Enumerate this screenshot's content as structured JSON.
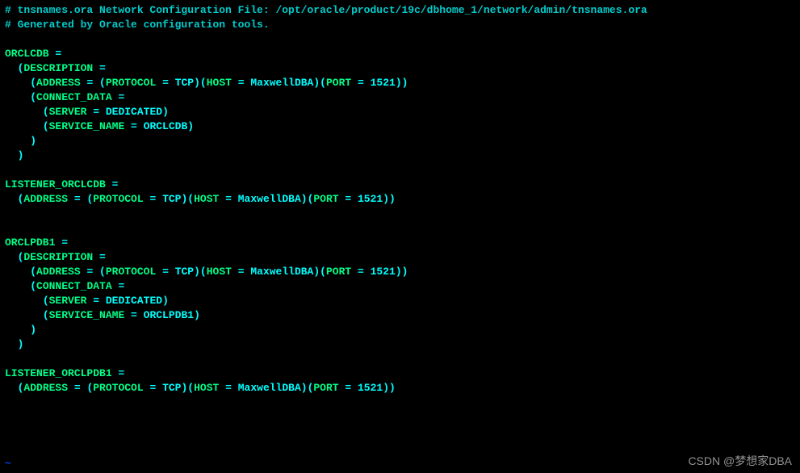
{
  "comments": {
    "line1": "# tnsnames.ora Network Configuration File: /opt/oracle/product/19c/dbhome_1/network/admin/tnsnames.ora",
    "line2": "# Generated by Oracle configuration tools."
  },
  "kw": {
    "description": "DESCRIPTION",
    "address": "ADDRESS",
    "protocol": "PROTOCOL",
    "host": "HOST",
    "port": "PORT",
    "connect_data": "CONNECT_DATA",
    "server": "SERVER",
    "service_name": "SERVICE_NAME"
  },
  "vals": {
    "tcp": "TCP",
    "host": "MaxwellDBA",
    "port": "1521",
    "dedicated": "DEDICATED"
  },
  "entries": {
    "orclcdb": {
      "name": "ORCLCDB",
      "service": "ORCLCDB"
    },
    "listener_orclcdb": {
      "name": "LISTENER_ORCLCDB"
    },
    "orclpdb1": {
      "name": "ORCLPDB1",
      "service": "ORCLPDB1"
    },
    "listener_orclpdb1": {
      "name": "LISTENER_ORCLPDB1"
    }
  },
  "sym": {
    "eq": " =",
    "eqsp": " = ",
    "lp": "(",
    "rp": ")"
  },
  "watermark": "CSDN @梦想家DBA",
  "tilde": "~"
}
